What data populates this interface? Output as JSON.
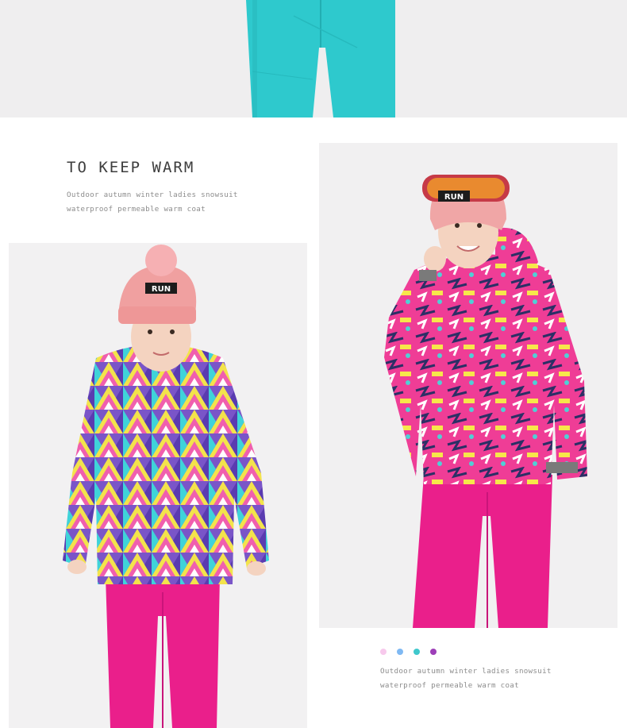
{
  "section": {
    "heading": "TO KEEP WARM",
    "caption_left": [
      "Outdoor autumn winter ladies snowsuit",
      "waterproof permeable warm coat"
    ],
    "caption_right": [
      "Outdoor autumn winter ladies snowsuit",
      "waterproof permeable warm coat"
    ]
  },
  "photos": {
    "left": {
      "hat_label": "RUN"
    },
    "right": {
      "hat_label": "RUN"
    }
  },
  "colors": {
    "swatches": [
      "#f7c9ec",
      "#7fb9f3",
      "#3fc8cc",
      "#9d3fb8"
    ],
    "pants_top": "#2fcbcf",
    "pants_pink": "#ea1f8b"
  }
}
